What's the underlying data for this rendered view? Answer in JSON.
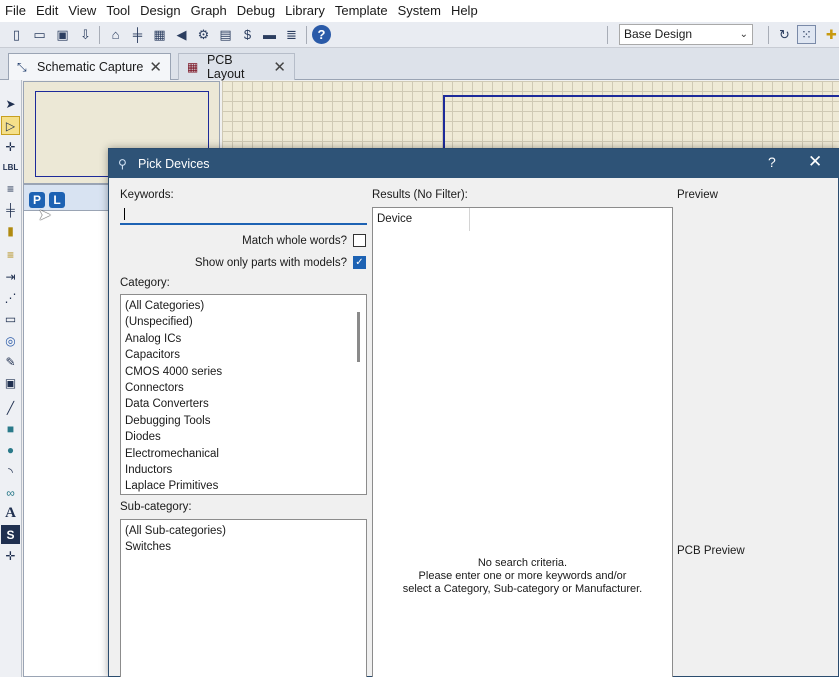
{
  "menu": [
    "File",
    "Edit",
    "View",
    "Tool",
    "Design",
    "Graph",
    "Debug",
    "Library",
    "Template",
    "System",
    "Help"
  ],
  "toolbar": {
    "icons": [
      "new-file-icon",
      "open-folder-icon",
      "save-icon",
      "import-icon",
      "home-icon",
      "schematic-icon",
      "pcb-icon",
      "gallery-icon",
      "3d-visualizer-icon",
      "gerber-icon",
      "bom-icon",
      "design-explorer-icon",
      "notes-icon",
      "help-icon"
    ],
    "variant": "Base Design"
  },
  "tabs": [
    {
      "label": "Schematic Capture",
      "icon": "schematic-tab-icon",
      "active": true
    },
    {
      "label": "PCB Layout",
      "icon": "pcb-tab-icon",
      "active": false
    }
  ],
  "selector": {
    "p_button": "P",
    "l_button": "L"
  },
  "dialog": {
    "title": "Pick Devices",
    "help": "?",
    "close": "✕",
    "keywords_label": "Keywords:",
    "keywords_value": "",
    "match_whole_words": "Match whole words?",
    "show_only_models": "Show only parts with models?",
    "category_label": "Category:",
    "categories": [
      "(All Categories)",
      "(Unspecified)",
      "Analog ICs",
      "Capacitors",
      "CMOS 4000 series",
      "Connectors",
      "Data Converters",
      "Debugging Tools",
      "Diodes",
      "Electromechanical",
      "Inductors",
      "Laplace Primitives"
    ],
    "subcategory_label": "Sub-category:",
    "subcategories": [
      "(All Sub-categories)",
      "Switches"
    ],
    "results_label": "Results (No Filter):",
    "results_column": "Device",
    "no_criteria": [
      "No search criteria.",
      "Please enter one or more keywords and/or",
      "select a Category, Sub-category or Manufacturer."
    ],
    "preview_label": "Preview",
    "pcb_preview_label": "PCB Preview"
  }
}
